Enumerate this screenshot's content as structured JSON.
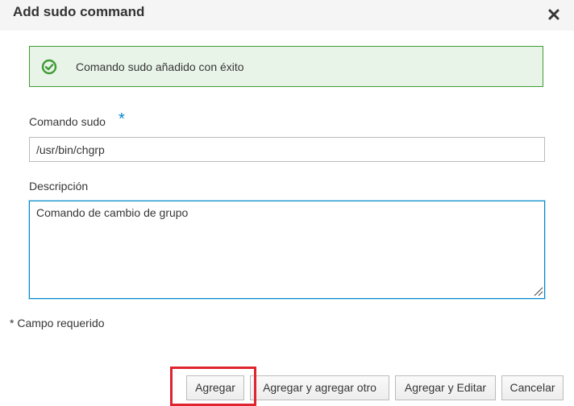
{
  "dialog": {
    "title": "Add sudo command",
    "close_icon": "close-icon"
  },
  "alert": {
    "icon": "check-circle-icon",
    "message": "Comando sudo añadido con éxito",
    "colors": {
      "border": "#3f9c35",
      "background": "#e9f4e9",
      "icon": "#3f9c35"
    }
  },
  "form": {
    "command": {
      "label": "Comando sudo",
      "required_mark": "*",
      "value": "/usr/bin/chgrp"
    },
    "description": {
      "label": "Descripción",
      "value": "Comando de cambio de grupo"
    },
    "required_note": "* Campo requerido"
  },
  "buttons": {
    "add": "Agregar",
    "add_another": "Agregar y agregar otro",
    "add_edit": "Agregar y Editar",
    "cancel": "Cancelar"
  },
  "highlight": {
    "target": "add-button",
    "color": "#e0242f"
  },
  "colors": {
    "accent": "#0088ce",
    "header_bg": "#f5f5f5"
  }
}
